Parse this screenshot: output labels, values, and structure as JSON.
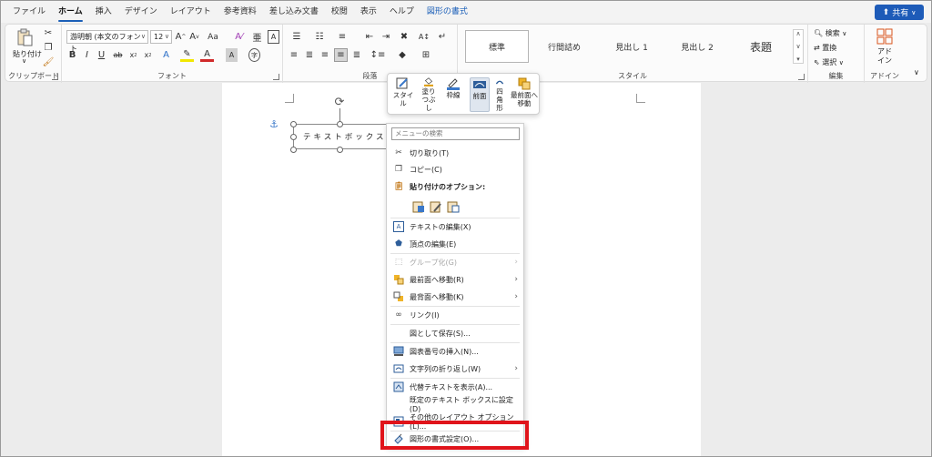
{
  "menubar": {
    "tabs": [
      "ファイル",
      "ホーム",
      "挿入",
      "デザイン",
      "レイアウト",
      "参考資料",
      "差し込み文書",
      "校閲",
      "表示",
      "ヘルプ",
      "図形の書式"
    ],
    "active_tab": "ホーム",
    "share_label": "共有"
  },
  "ribbon": {
    "clipboard": {
      "paste_label": "貼り付け",
      "group_label": "クリップボード"
    },
    "font": {
      "font_name": "游明朝 (本文のフォント",
      "font_size": "12",
      "aa_label": "Aa",
      "group_label": "フォント"
    },
    "paragraph": {
      "group_label": "段落"
    },
    "styles": {
      "items": [
        "標準",
        "行間詰め",
        "見出し 1",
        "見出し 2",
        "表題"
      ],
      "group_label": "スタイル"
    },
    "editing": {
      "find_label": "検索",
      "replace_label": "置換",
      "select_label": "選択",
      "group_label": "編集"
    },
    "addin": {
      "label_line1": "アド",
      "label_line2": "イン",
      "group_label": "アドイン"
    }
  },
  "document": {
    "textbox_text": "テキストボックス"
  },
  "minibar": {
    "style": "スタイル",
    "fill": "塗りつぶし",
    "outline": "枠線",
    "front": "前面",
    "square": "四角形",
    "bring_front": "最前面へ移動"
  },
  "context_menu": {
    "search_placeholder": "メニューの検索",
    "items": {
      "cut": "切り取り(T)",
      "copy": "コピー(C)",
      "paste_options": "貼り付けのオプション:",
      "edit_text": "テキストの編集(X)",
      "edit_points": "頂点の編集(E)",
      "group": "グループ化(G)",
      "bring_front": "最前面へ移動(R)",
      "send_back": "最背面へ移動(K)",
      "link": "リンク(I)",
      "save_as_picture": "図として保存(S)...",
      "insert_caption": "図表番号の挿入(N)...",
      "wrap_text": "文字列の折り返し(W)",
      "alt_text": "代替テキストを表示(A)...",
      "set_default": "既定のテキスト ボックスに設定(D)",
      "more_layout": "その他のレイアウト オプション(L)...",
      "format_shape": "図形の書式設定(O)..."
    }
  },
  "colors": {
    "accent": "#1b5fb8",
    "highlight": "#e0141b"
  }
}
